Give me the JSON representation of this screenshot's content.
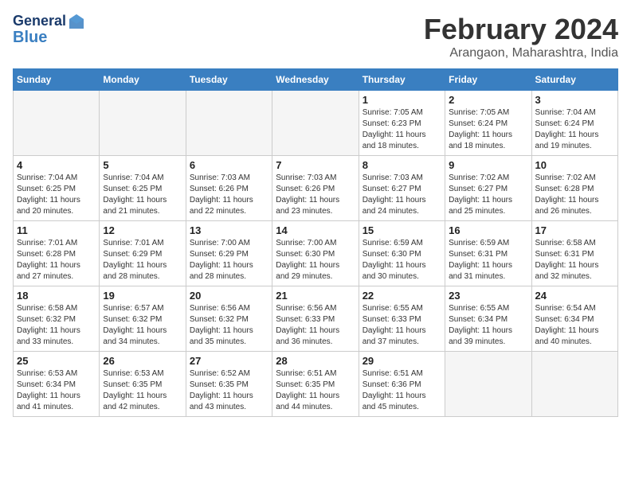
{
  "logo": {
    "line1": "General",
    "line2": "Blue"
  },
  "title": "February 2024",
  "location": "Arangaon, Maharashtra, India",
  "weekdays": [
    "Sunday",
    "Monday",
    "Tuesday",
    "Wednesday",
    "Thursday",
    "Friday",
    "Saturday"
  ],
  "weeks": [
    [
      {
        "day": "",
        "info": ""
      },
      {
        "day": "",
        "info": ""
      },
      {
        "day": "",
        "info": ""
      },
      {
        "day": "",
        "info": ""
      },
      {
        "day": "1",
        "info": "Sunrise: 7:05 AM\nSunset: 6:23 PM\nDaylight: 11 hours\nand 18 minutes."
      },
      {
        "day": "2",
        "info": "Sunrise: 7:05 AM\nSunset: 6:24 PM\nDaylight: 11 hours\nand 18 minutes."
      },
      {
        "day": "3",
        "info": "Sunrise: 7:04 AM\nSunset: 6:24 PM\nDaylight: 11 hours\nand 19 minutes."
      }
    ],
    [
      {
        "day": "4",
        "info": "Sunrise: 7:04 AM\nSunset: 6:25 PM\nDaylight: 11 hours\nand 20 minutes."
      },
      {
        "day": "5",
        "info": "Sunrise: 7:04 AM\nSunset: 6:25 PM\nDaylight: 11 hours\nand 21 minutes."
      },
      {
        "day": "6",
        "info": "Sunrise: 7:03 AM\nSunset: 6:26 PM\nDaylight: 11 hours\nand 22 minutes."
      },
      {
        "day": "7",
        "info": "Sunrise: 7:03 AM\nSunset: 6:26 PM\nDaylight: 11 hours\nand 23 minutes."
      },
      {
        "day": "8",
        "info": "Sunrise: 7:03 AM\nSunset: 6:27 PM\nDaylight: 11 hours\nand 24 minutes."
      },
      {
        "day": "9",
        "info": "Sunrise: 7:02 AM\nSunset: 6:27 PM\nDaylight: 11 hours\nand 25 minutes."
      },
      {
        "day": "10",
        "info": "Sunrise: 7:02 AM\nSunset: 6:28 PM\nDaylight: 11 hours\nand 26 minutes."
      }
    ],
    [
      {
        "day": "11",
        "info": "Sunrise: 7:01 AM\nSunset: 6:28 PM\nDaylight: 11 hours\nand 27 minutes."
      },
      {
        "day": "12",
        "info": "Sunrise: 7:01 AM\nSunset: 6:29 PM\nDaylight: 11 hours\nand 28 minutes."
      },
      {
        "day": "13",
        "info": "Sunrise: 7:00 AM\nSunset: 6:29 PM\nDaylight: 11 hours\nand 28 minutes."
      },
      {
        "day": "14",
        "info": "Sunrise: 7:00 AM\nSunset: 6:30 PM\nDaylight: 11 hours\nand 29 minutes."
      },
      {
        "day": "15",
        "info": "Sunrise: 6:59 AM\nSunset: 6:30 PM\nDaylight: 11 hours\nand 30 minutes."
      },
      {
        "day": "16",
        "info": "Sunrise: 6:59 AM\nSunset: 6:31 PM\nDaylight: 11 hours\nand 31 minutes."
      },
      {
        "day": "17",
        "info": "Sunrise: 6:58 AM\nSunset: 6:31 PM\nDaylight: 11 hours\nand 32 minutes."
      }
    ],
    [
      {
        "day": "18",
        "info": "Sunrise: 6:58 AM\nSunset: 6:32 PM\nDaylight: 11 hours\nand 33 minutes."
      },
      {
        "day": "19",
        "info": "Sunrise: 6:57 AM\nSunset: 6:32 PM\nDaylight: 11 hours\nand 34 minutes."
      },
      {
        "day": "20",
        "info": "Sunrise: 6:56 AM\nSunset: 6:32 PM\nDaylight: 11 hours\nand 35 minutes."
      },
      {
        "day": "21",
        "info": "Sunrise: 6:56 AM\nSunset: 6:33 PM\nDaylight: 11 hours\nand 36 minutes."
      },
      {
        "day": "22",
        "info": "Sunrise: 6:55 AM\nSunset: 6:33 PM\nDaylight: 11 hours\nand 37 minutes."
      },
      {
        "day": "23",
        "info": "Sunrise: 6:55 AM\nSunset: 6:34 PM\nDaylight: 11 hours\nand 39 minutes."
      },
      {
        "day": "24",
        "info": "Sunrise: 6:54 AM\nSunset: 6:34 PM\nDaylight: 11 hours\nand 40 minutes."
      }
    ],
    [
      {
        "day": "25",
        "info": "Sunrise: 6:53 AM\nSunset: 6:34 PM\nDaylight: 11 hours\nand 41 minutes."
      },
      {
        "day": "26",
        "info": "Sunrise: 6:53 AM\nSunset: 6:35 PM\nDaylight: 11 hours\nand 42 minutes."
      },
      {
        "day": "27",
        "info": "Sunrise: 6:52 AM\nSunset: 6:35 PM\nDaylight: 11 hours\nand 43 minutes."
      },
      {
        "day": "28",
        "info": "Sunrise: 6:51 AM\nSunset: 6:35 PM\nDaylight: 11 hours\nand 44 minutes."
      },
      {
        "day": "29",
        "info": "Sunrise: 6:51 AM\nSunset: 6:36 PM\nDaylight: 11 hours\nand 45 minutes."
      },
      {
        "day": "",
        "info": ""
      },
      {
        "day": "",
        "info": ""
      }
    ]
  ]
}
